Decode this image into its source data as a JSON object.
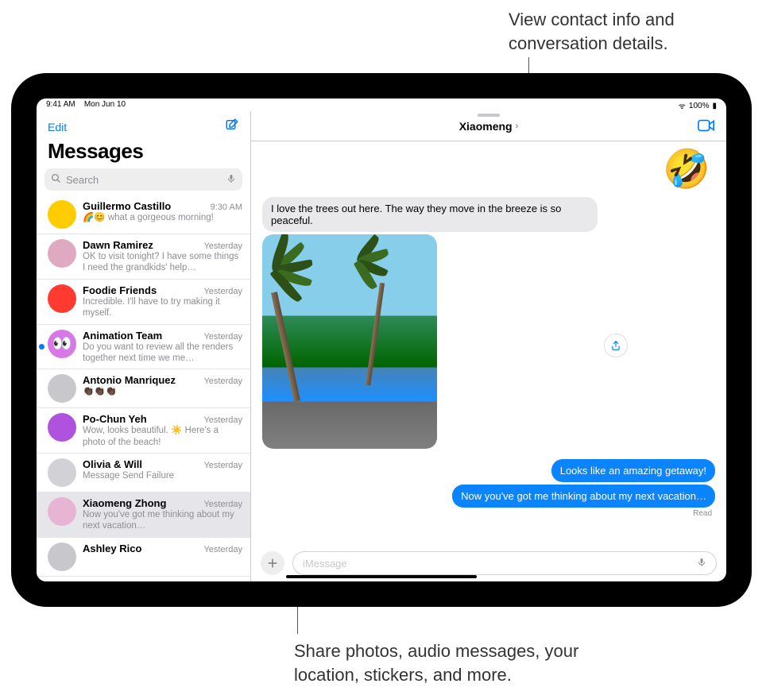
{
  "callouts": {
    "top": "View contact info and conversation details.",
    "bottom": "Share photos, audio messages, your location, stickers, and more."
  },
  "status": {
    "time": "9:41 AM",
    "date": "Mon Jun 10",
    "battery": "100%"
  },
  "sidebar": {
    "edit_label": "Edit",
    "title": "Messages",
    "search_placeholder": "Search"
  },
  "conversations": [
    {
      "name": "Guillermo Castillo",
      "time": "9:30 AM",
      "preview": "🌈😊 what a gorgeous morning!",
      "avatar_bg": "#ffcc00",
      "unread": false
    },
    {
      "name": "Dawn Ramirez",
      "time": "Yesterday",
      "preview": "OK to visit tonight? I have some things I need the grandkids' help…",
      "avatar_bg": "#e0a9c2",
      "unread": false
    },
    {
      "name": "Foodie Friends",
      "time": "Yesterday",
      "preview": "Incredible. I'll have to try making it myself.",
      "avatar_bg": "#ff3b30",
      "unread": false
    },
    {
      "name": "Animation Team",
      "time": "Yesterday",
      "preview": "Do you want to review all the renders together next time we me…",
      "avatar_bg": "#d977e8",
      "unread": true,
      "avatar_emoji": "👀"
    },
    {
      "name": "Antonio Manriquez",
      "time": "Yesterday",
      "preview": "👏🏿👏🏿👏🏿",
      "avatar_bg": "#c7c7cc",
      "unread": false
    },
    {
      "name": "Po-Chun Yeh",
      "time": "Yesterday",
      "preview": "Wow, looks beautiful. ☀️ Here's a photo of the beach!",
      "avatar_bg": "#af52de",
      "unread": false
    },
    {
      "name": "Olivia & Will",
      "time": "Yesterday",
      "preview": "Message Send Failure",
      "avatar_bg": "#d1d1d6",
      "unread": false
    },
    {
      "name": "Xiaomeng Zhong",
      "time": "Yesterday",
      "preview": "Now you've got me thinking about my next vacation…",
      "avatar_bg": "#e8b4d4",
      "unread": false,
      "selected": true
    },
    {
      "name": "Ashley Rico",
      "time": "Yesterday",
      "preview": "",
      "avatar_bg": "#c7c7cc",
      "unread": false
    }
  ],
  "chat": {
    "header_name": "Xiaomeng",
    "reaction_emoji": "🤣",
    "incoming_text": "I love the trees out here. The way they move in the breeze is so peaceful.",
    "outgoing_1": "Looks like an amazing getaway!",
    "outgoing_2": "Now you've got me thinking about my next vacation…",
    "read_label": "Read",
    "input_placeholder": "iMessage"
  }
}
